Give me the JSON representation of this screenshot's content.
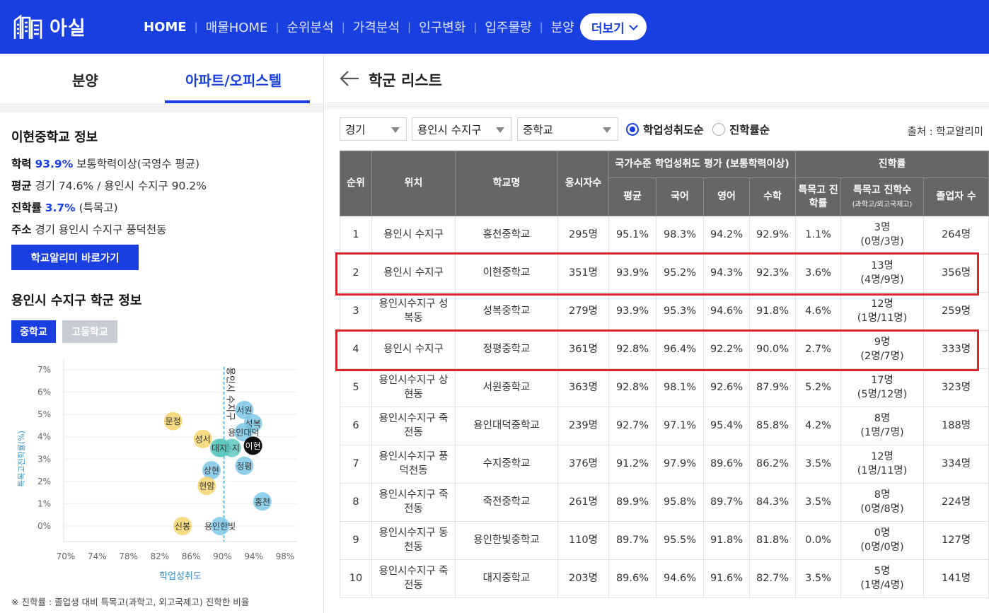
{
  "app": {
    "name": "아실"
  },
  "nav": {
    "items": [
      "HOME",
      "매물HOME",
      "순위분석",
      "가격분석",
      "인구변화",
      "입주물량",
      "분양"
    ],
    "more_label": "더보기"
  },
  "left": {
    "tabs": [
      "분양",
      "아파트/오피스텔"
    ],
    "school": {
      "title": "이현중학교 정보",
      "achievement_label": "학력",
      "achievement_value": "93.9%",
      "achievement_desc": "보통학력이상(국영수 평균)",
      "average_label": "평균",
      "average_desc": "경기 74.6% / 용인시 수지구 90.2%",
      "advance_label": "진학률",
      "advance_value": "3.7%",
      "advance_desc": "(특목고)",
      "address_label": "주소",
      "address_value": "경기 용인시 수지구 풍덕천동",
      "link_label": "학교알리미 바로가기"
    },
    "district_title": "용인시 수지구 학군 정보",
    "levels": [
      "중학교",
      "고등학교"
    ],
    "footnote": "※ 진학률 : 졸업생 대비 특목고(과학고, 외고국제고) 진학한 비율"
  },
  "chart_data": {
    "type": "scatter",
    "xlabel": "학업성취도",
    "ylabel": "특목고진학률(%)",
    "xlim": [
      70,
      100
    ],
    "ylim": [
      0,
      7
    ],
    "x_ticks": [
      "70%",
      "74%",
      "78%",
      "82%",
      "86%",
      "90%",
      "94%",
      "98%"
    ],
    "y_ticks": [
      "0%",
      "1%",
      "2%",
      "3%",
      "4%",
      "5%",
      "6%",
      "7%"
    ],
    "reference_line": {
      "x": 90.2,
      "label": "용인시 수지구"
    },
    "points": [
      {
        "label": "서원",
        "x": 92.8,
        "y": 5.2,
        "color": "#7ec8e8"
      },
      {
        "label": "성복",
        "x": 93.9,
        "y": 4.6,
        "color": "#7ec8e8"
      },
      {
        "label": "용인대덕",
        "x": 92.7,
        "y": 4.2,
        "color": "#7ec8e8"
      },
      {
        "label": "이현",
        "x": 93.9,
        "y": 3.6,
        "color": "#111111"
      },
      {
        "label": "정평",
        "x": 92.8,
        "y": 2.7,
        "color": "#7ec8e8"
      },
      {
        "label": "수지",
        "x": 91.2,
        "y": 3.5,
        "color": "#5cc8c0"
      },
      {
        "label": "죽전",
        "x": 89.9,
        "y": 3.5,
        "color": "#5cc8c0"
      },
      {
        "label": "대지",
        "x": 89.6,
        "y": 3.5,
        "color": "#5cc8c0"
      },
      {
        "label": "홍천",
        "x": 95.1,
        "y": 1.1,
        "color": "#7ec8e8"
      },
      {
        "label": "용인한빛",
        "x": 89.7,
        "y": 0.0,
        "color": "#7ec8e8"
      },
      {
        "label": "상현",
        "x": 88.6,
        "y": 2.5,
        "color": "#7ec8e8"
      },
      {
        "label": "문정",
        "x": 83.7,
        "y": 4.7,
        "color": "#f6d46e"
      },
      {
        "label": "성서",
        "x": 87.5,
        "y": 3.9,
        "color": "#f6d46e"
      },
      {
        "label": "현암",
        "x": 88.0,
        "y": 1.8,
        "color": "#f6d46e"
      },
      {
        "label": "신봉",
        "x": 84.9,
        "y": 0.0,
        "color": "#f6d46e"
      }
    ]
  },
  "right": {
    "title": "학군 리스트",
    "filters": {
      "region": "경기",
      "district": "용인시 수지구",
      "level": "중학교"
    },
    "sort_options": [
      "학업성취도순",
      "진학률순"
    ],
    "source": "출처 : 학교알리미",
    "table": {
      "headers": {
        "rank": "순위",
        "location": "위치",
        "school": "학교명",
        "test_takers": "응시자수",
        "group_eval": "국가수준 학업성취도 평가 (보통학력이상)",
        "avg": "평균",
        "korean": "국어",
        "english": "영어",
        "math": "수학",
        "group_adv": "진학률",
        "adv_rate": "특목고 진학률",
        "adv_count": "특목고 진학수",
        "adv_count_sub": "(과학고/외고국제고)",
        "graduates": "졸업자 수"
      },
      "rows": [
        [
          "1",
          "용인시 수지구",
          "홍천중학교",
          "295명",
          "95.1%",
          "98.3%",
          "94.2%",
          "92.9%",
          "1.1%",
          "3명",
          "(0명/3명)",
          "264명"
        ],
        [
          "2",
          "용인시 수지구",
          "이현중학교",
          "351명",
          "93.9%",
          "95.2%",
          "94.3%",
          "92.3%",
          "3.6%",
          "13명",
          "(4명/9명)",
          "356명"
        ],
        [
          "3",
          "용인시수지구 성복동",
          "성복중학교",
          "279명",
          "93.9%",
          "95.3%",
          "94.6%",
          "91.8%",
          "4.6%",
          "12명",
          "(1명/11명)",
          "259명"
        ],
        [
          "4",
          "용인시 수지구",
          "정평중학교",
          "361명",
          "92.8%",
          "96.4%",
          "92.2%",
          "90.0%",
          "2.7%",
          "9명",
          "(2명/7명)",
          "333명"
        ],
        [
          "5",
          "용인시수지구 상현동",
          "서원중학교",
          "363명",
          "92.8%",
          "98.1%",
          "92.6%",
          "87.9%",
          "5.2%",
          "17명",
          "(5명/12명)",
          "323명"
        ],
        [
          "6",
          "용인시수지구 죽전동",
          "용인대덕중학교",
          "239명",
          "92.7%",
          "97.1%",
          "95.4%",
          "85.8%",
          "4.2%",
          "8명",
          "(1명/7명)",
          "188명"
        ],
        [
          "7",
          "용인시수지구 풍덕천동",
          "수지중학교",
          "376명",
          "91.2%",
          "97.9%",
          "89.6%",
          "86.2%",
          "3.5%",
          "12명",
          "(1명/11명)",
          "334명"
        ],
        [
          "8",
          "용인시수지구 죽전동",
          "죽전중학교",
          "261명",
          "89.9%",
          "95.8%",
          "89.7%",
          "84.3%",
          "3.5%",
          "8명",
          "(0명/8명)",
          "224명"
        ],
        [
          "9",
          "용인시수지구 동천동",
          "용인한빛중학교",
          "110명",
          "89.7%",
          "95.5%",
          "91.8%",
          "81.8%",
          "0.0%",
          "0명",
          "(0명/0명)",
          "127명"
        ],
        [
          "10",
          "용인시수지구 죽전동",
          "대지중학교",
          "203명",
          "89.6%",
          "94.6%",
          "91.6%",
          "82.7%",
          "3.5%",
          "5명",
          "(1명/4명)",
          "141명"
        ]
      ]
    }
  }
}
